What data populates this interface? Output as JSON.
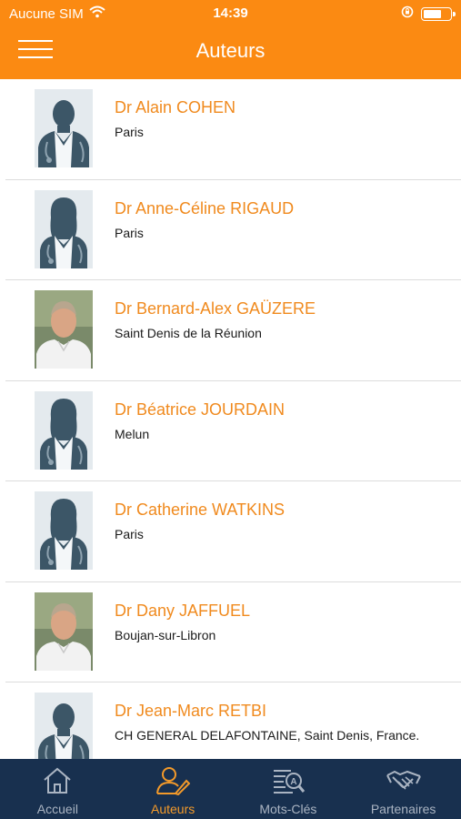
{
  "status_bar": {
    "carrier": "Aucune SIM",
    "time": "14:39",
    "battery_level": 0.7
  },
  "header": {
    "title": "Auteurs"
  },
  "colors": {
    "accent": "#fb8a12",
    "name_text": "#f08a1e",
    "tabbar_bg": "#18304f"
  },
  "authors": [
    {
      "name": "Dr Alain COHEN",
      "city": "Paris",
      "avatar": "silhouette-male-icon"
    },
    {
      "name": "Dr Anne-Céline RIGAUD",
      "city": "Paris",
      "avatar": "silhouette-female-icon"
    },
    {
      "name": "Dr Bernard-Alex GAÜZERE",
      "city": "Saint Denis de la Réunion",
      "avatar": "photo-portrait"
    },
    {
      "name": "Dr Béatrice JOURDAIN",
      "city": "Melun",
      "avatar": "silhouette-female-icon"
    },
    {
      "name": "Dr Catherine  WATKINS",
      "city": "Paris",
      "avatar": "silhouette-female-icon"
    },
    {
      "name": "Dr Dany JAFFUEL",
      "city": "Boujan-sur-Libron",
      "avatar": "photo-portrait"
    },
    {
      "name": "Dr Jean-Marc  RETBI",
      "city": "CH GENERAL DELAFONTAINE, Saint Denis, France.",
      "avatar": "silhouette-male-icon"
    }
  ],
  "tabs": [
    {
      "label": "Accueil",
      "icon": "home-icon",
      "active": false
    },
    {
      "label": "Auteurs",
      "icon": "author-icon",
      "active": true
    },
    {
      "label": "Mots-Clés",
      "icon": "keywords-icon",
      "active": false
    },
    {
      "label": "Partenaires",
      "icon": "handshake-icon",
      "active": false
    }
  ]
}
